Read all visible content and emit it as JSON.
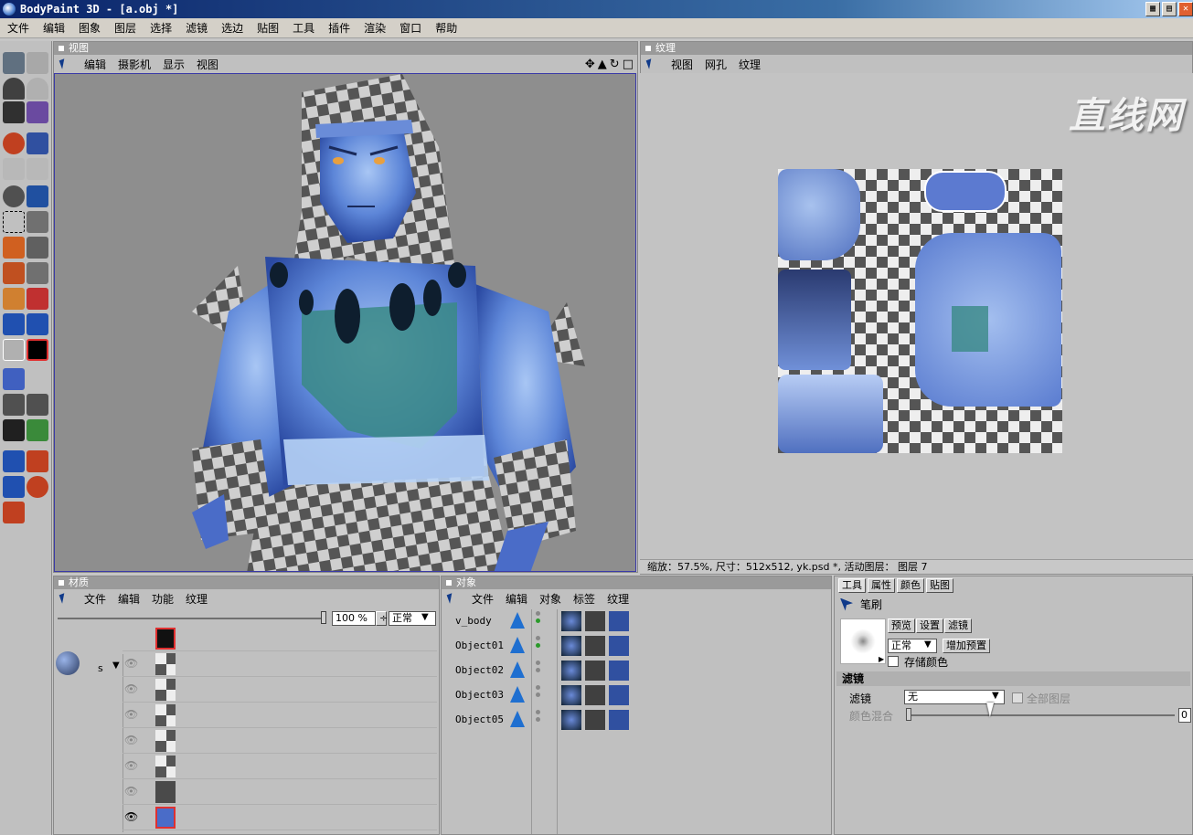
{
  "window": {
    "title": "BodyPaint 3D - [a.obj *]"
  },
  "menubar": {
    "items": [
      "文件",
      "编辑",
      "图象",
      "图层",
      "选择",
      "滤镜",
      "选边",
      "贴图",
      "工具",
      "插件",
      "渲染",
      "窗口",
      "帮助"
    ]
  },
  "viewport": {
    "title": "视图",
    "menu": [
      "编辑",
      "摄影机",
      "显示",
      "视图"
    ],
    "nav_icons": [
      "move-icon",
      "zoom-icon",
      "rotate-icon",
      "maximize-icon"
    ]
  },
  "texture": {
    "title": "纹理",
    "menu": [
      "视图",
      "网孔",
      "纹理"
    ],
    "watermark": "直线网",
    "status": "缩放：57.5%, 尺寸：512x512, yk.psd *, 活动图层： 图层 7"
  },
  "materials": {
    "title": "材质",
    "menu": [
      "文件",
      "编辑",
      "功能",
      "纹理"
    ],
    "opacity": "100 %",
    "blend": "正常",
    "channel_letter": "s",
    "layer_count": 9
  },
  "objects": {
    "title": "对象",
    "menu": [
      "文件",
      "编辑",
      "对象",
      "标签",
      "纹理"
    ],
    "items": [
      "v_body",
      "Object01",
      "Object02",
      "Object03",
      "Object05"
    ]
  },
  "attributes": {
    "tabs": [
      "工具",
      "属性",
      "颜色",
      "贴图"
    ],
    "tool_name": "笔刷",
    "preview_buttons": [
      "预览",
      "设置",
      "滤镜"
    ],
    "mode": "正常",
    "add_preset": "增加预置",
    "store_color": "存储颜色",
    "section": "滤镜",
    "filter_label": "滤镜",
    "filter_value": "无",
    "all_layers": "全部图层",
    "color_mix": "颜色混合",
    "mix_value": "0"
  },
  "colors": {
    "accent": "#3a3aa8",
    "panel": "#c0c0c0",
    "title_gradient_start": "#0a246a"
  }
}
